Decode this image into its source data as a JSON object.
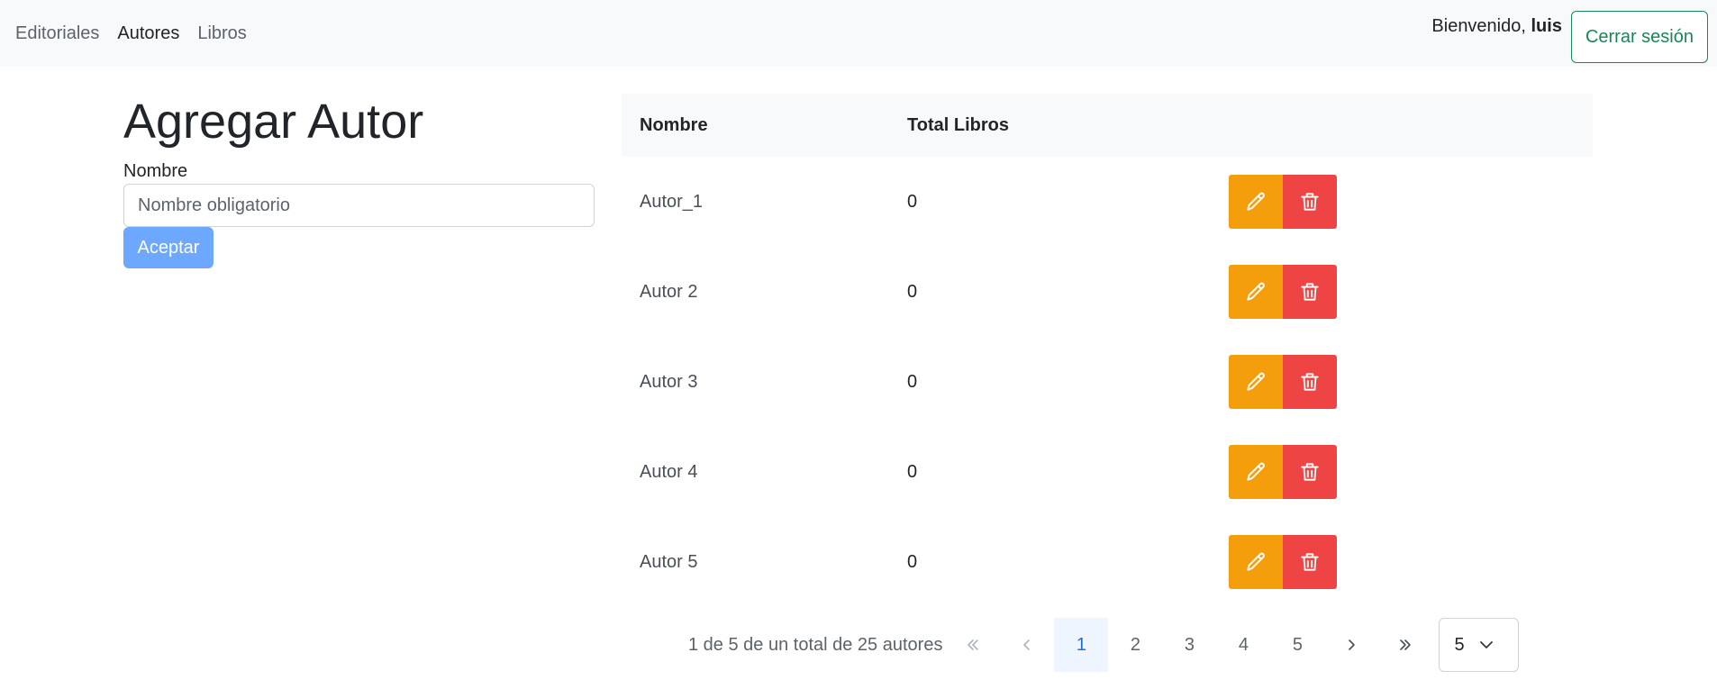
{
  "nav": {
    "links": [
      "Editoriales",
      "Autores",
      "Libros"
    ],
    "active": "Autores",
    "welcome_prefix": "Bienvenido,",
    "username": "luis",
    "logout_label": "Cerrar sesión"
  },
  "form": {
    "title": "Agregar Autor",
    "name_label": "Nombre",
    "name_placeholder": "Nombre obligatorio",
    "name_value": "",
    "submit_label": "Aceptar"
  },
  "table": {
    "headers": [
      "Nombre",
      "Total Libros",
      ""
    ],
    "rows": [
      {
        "name": "Autor_1",
        "total": "0"
      },
      {
        "name": "Autor 2",
        "total": "0"
      },
      {
        "name": "Autor 3",
        "total": "0"
      },
      {
        "name": "Autor 4",
        "total": "0"
      },
      {
        "name": "Autor 5",
        "total": "0"
      }
    ],
    "row_actions": [
      {
        "icon": "pencil-icon",
        "color": "#f59e0b"
      },
      {
        "icon": "trash-icon",
        "color": "#ef4444"
      }
    ]
  },
  "pagination": {
    "summary": "1 de 5 de un total de 25 autores",
    "pages": [
      "1",
      "2",
      "3",
      "4",
      "5"
    ],
    "current_page": "1",
    "first_icon": "double-chevron-left-icon",
    "prev_icon": "chevron-left-icon",
    "next_icon": "chevron-right-icon",
    "last_icon": "double-chevron-right-icon",
    "page_size": "5"
  },
  "colors": {
    "accent": "#198754",
    "primary_light": "#6ea8fe",
    "edit": "#f59e0b",
    "delete": "#ef4444",
    "navbar_bg": "#f8f9fa"
  }
}
